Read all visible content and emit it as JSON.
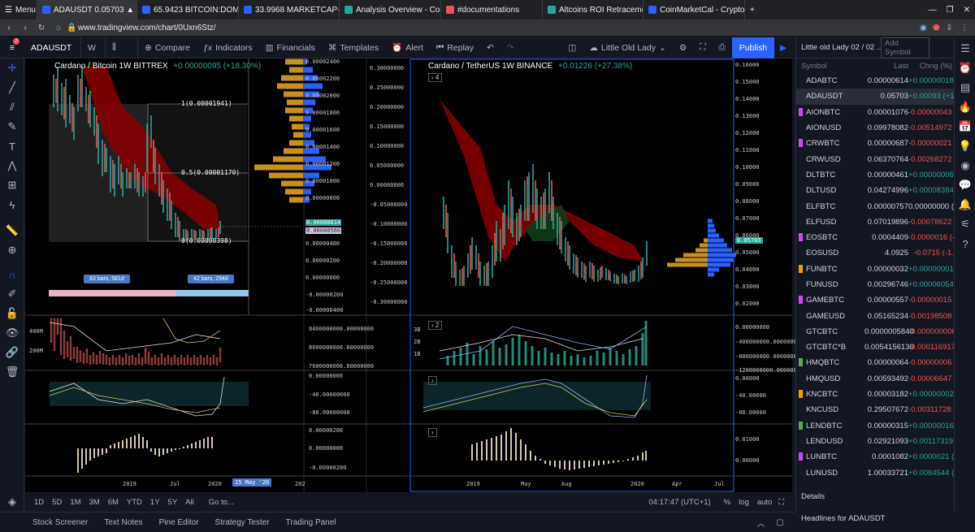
{
  "browser": {
    "menu_label": "Menu",
    "tabs": [
      {
        "title": "ADAUSDT 0.05703 ▲ +1.6€",
        "color": "#2962ff"
      },
      {
        "title": "65.9423 BITCOIN:DOMINA",
        "color": "#2962ff"
      },
      {
        "title": "33.9968 MARKETCAP-ALTC",
        "color": "#2962ff"
      },
      {
        "title": "Analysis Overview - CoinCh",
        "color": "#26a69a"
      },
      {
        "title": "#documentations",
        "color": "#ef5350"
      },
      {
        "title": "Altcoins ROI Retracements",
        "color": "#26a69a"
      },
      {
        "title": "CoinMarketCal - Cryptocur",
        "color": "#2962ff"
      }
    ],
    "url": "www.tradingview.com/chart/0Uxn6Stz/"
  },
  "toolbar": {
    "symbol": "ADAUSDT",
    "interval": "W",
    "compare": "Compare",
    "indicators": "Indicators",
    "financials": "Financials",
    "templates": "Templates",
    "alert": "Alert",
    "replay": "Replay",
    "layout_name": "Little Old Lady",
    "publish": "Publish"
  },
  "left_chart": {
    "title": "Cardano / Bitcoin   1W   BITTREX",
    "change": "+0.00000095 (+18.30%)",
    "fib_top": "1(0.00001941)",
    "fib_mid": "0.5(0.00001170)",
    "fib_bot": "0(0.00000398)",
    "range_left": "83 bars, 581d",
    "range_right": "42 bars, 294d",
    "price_ticks": [
      "0.00002400",
      "0.00002200",
      "0.00002000",
      "0.00001800",
      "0.00001600",
      "0.00001400",
      "0.00001200",
      "0.00001000",
      "0.00000800",
      "0.00000600",
      "0.00000400",
      "0.00000200",
      "0.00000000",
      "-0.00000200",
      "-0.00000400"
    ],
    "price_now": "0.00000614",
    "price_alt": "0.00000560",
    "scale2_ticks": [
      "0.30000000",
      "0.25000000",
      "0.20000000",
      "0.15000000",
      "0.10000000",
      "0.05000000",
      "0.00000000",
      "-0.05000000",
      "-0.10000000",
      "-0.15000000",
      "-0.20000000",
      "-0.25000000",
      "-0.30000000"
    ],
    "vol_ticks": [
      "400M",
      "200M"
    ],
    "vol_scale": [
      "8400000000.00000000",
      "8000000000.00000000",
      "7600000000.00000000"
    ],
    "osc_ticks": [
      "0.00000000",
      "-40.00000000",
      "-80.00000000"
    ],
    "macd_ticks": [
      "0.00000200",
      "0.00000000",
      "-0.00000200"
    ],
    "time_labels": [
      "2019",
      "Jul",
      "2020"
    ],
    "cursor_date": "25 May '20",
    "extra_label": "202"
  },
  "right_chart": {
    "title": "Cardano / TetherUS   1W   BINANCE",
    "change": "+0.01226 (+27.38%)",
    "legend_count": "4",
    "pane_count": "2",
    "price_ticks": [
      "0.16000",
      "0.15000",
      "0.14000",
      "0.13000",
      "0.12000",
      "0.11000",
      "0.10000",
      "0.09000",
      "0.08000",
      "0.07000",
      "0.06000",
      "0.05000",
      "0.04000",
      "0.03000",
      "0.02000"
    ],
    "price_now": "0.05703",
    "vol_ticks": [
      "3B",
      "2B",
      "1B"
    ],
    "vol_scale": [
      "0.00000000",
      "-400000000.00000000",
      "-800000000.00000000",
      "-1200000000.00000000"
    ],
    "osc_ticks": [
      "0.00000",
      "-40.00000",
      "-80.00000"
    ],
    "macd_ticks": [
      "0.01000",
      "0.00000"
    ],
    "time_labels": [
      "2019",
      "May",
      "Aug",
      "2020",
      "Apr",
      "Jul"
    ]
  },
  "timeframes": [
    "1D",
    "5D",
    "1M",
    "3M",
    "6M",
    "YTD",
    "1Y",
    "5Y",
    "All",
    "Go to..."
  ],
  "clock": "04:17:47 (UTC+1)",
  "scale_opts": [
    "%",
    "log",
    "auto"
  ],
  "bottom_tabs": [
    "Stock Screener",
    "Text Notes",
    "Pine Editor",
    "Strategy Tester",
    "Trading Panel"
  ],
  "watchlist": {
    "name": "Little old Lady 02 / 02 ...",
    "add": "Add Symbol",
    "headers": [
      "Symbol",
      "Last",
      "Chng (%)"
    ],
    "rows": [
      {
        "sym": "ADABTC",
        "last": "0.00000614",
        "chg": "+0.00000018 (+3.02%)",
        "dir": "up",
        "flag": ""
      },
      {
        "sym": "ADAUSDT",
        "last": "0.05703",
        "chg": "+0.00093 (+1.66%)",
        "dir": "up",
        "flag": "#2a2e39"
      },
      {
        "sym": "AIONBTC",
        "last": "0.00001076",
        "chg": "-0.00000043 (-3.84%)",
        "dir": "dn",
        "flag": "#e040fb"
      },
      {
        "sym": "AIONUSD",
        "last": "0.09978082",
        "chg": "-0.00514972 (-4.91%)",
        "dir": "dn",
        "flag": ""
      },
      {
        "sym": "CRWBTC",
        "last": "0.00000687",
        "chg": "-0.00000021 (-2.97%)",
        "dir": "dn",
        "flag": "#e040fb"
      },
      {
        "sym": "CRWUSD",
        "last": "0.06370764",
        "chg": "-0.00268272 (-4.04%)",
        "dir": "dn",
        "flag": ""
      },
      {
        "sym": "DLTBTC",
        "last": "0.00000461",
        "chg": "+0.00000006 (+1.32%)",
        "dir": "up",
        "flag": ""
      },
      {
        "sym": "DLTUSD",
        "last": "0.04274996",
        "chg": "+0.00008384 (+0.20%)",
        "dir": "up",
        "flag": ""
      },
      {
        "sym": "ELFBTC",
        "last": "0.00000757",
        "chg": "0.00000000 (0.00%)",
        "dir": "flat",
        "flag": ""
      },
      {
        "sym": "ELFUSD",
        "last": "0.07019896",
        "chg": "-0.00078622 (-1.11%)",
        "dir": "dn",
        "flag": ""
      },
      {
        "sym": "EOSBTC",
        "last": "0.0004409",
        "chg": "-0.0000016 (-0.36%)",
        "dir": "dn",
        "flag": "#e040fb"
      },
      {
        "sym": "EOSUSD",
        "last": "4.0925",
        "chg": "-0.0715 (-1.72%)",
        "dir": "dn",
        "flag": ""
      },
      {
        "sym": "FUNBTC",
        "last": "0.00000032",
        "chg": "+0.00000001 (+3.23%)",
        "dir": "up",
        "flag": "#ff9800"
      },
      {
        "sym": "FUNUSD",
        "last": "0.00296746",
        "chg": "+0.00006054 (+2.08%)",
        "dir": "up",
        "flag": ""
      },
      {
        "sym": "GAMEBTC",
        "last": "0.00000557",
        "chg": "-0.00000015 (-2.62%)",
        "dir": "dn",
        "flag": "#e040fb"
      },
      {
        "sym": "GAMEUSD",
        "last": "0.05165234",
        "chg": "-0.00198508 (-3.70%)",
        "dir": "dn",
        "flag": ""
      },
      {
        "sym": "GTCBTC",
        "last": "0.0000005840",
        "chg": "-0.0000000060 (-1.02",
        "dir": "dn",
        "flag": ""
      },
      {
        "sym": "GTCBTC*B",
        "last": "0.0054156130",
        "chg": "-0.0001169173 (-2.11",
        "dir": "dn",
        "flag": ""
      },
      {
        "sym": "HMQBTC",
        "last": "0.00000064",
        "chg": "-0.00000006 (-8.57%)",
        "dir": "dn",
        "flag": "#4caf50"
      },
      {
        "sym": "HMQUSD",
        "last": "0.00593492",
        "chg": "-0.00006647 (-1.11%)",
        "dir": "dn",
        "flag": ""
      },
      {
        "sym": "KNCBTC",
        "last": "0.00003182",
        "chg": "+0.00000002 (+0.06%)",
        "dir": "up",
        "flag": "#ff9800"
      },
      {
        "sym": "KNCUSD",
        "last": "0.29507672",
        "chg": "-0.00311728 (-1.05%)",
        "dir": "dn",
        "flag": ""
      },
      {
        "sym": "LENDBTC",
        "last": "0.00000315",
        "chg": "+0.00000016 (+5.35%)",
        "dir": "up",
        "flag": "#4caf50"
      },
      {
        "sym": "LENDUSD",
        "last": "0.02921093",
        "chg": "+0.00117319 (+4.18%)",
        "dir": "up",
        "flag": ""
      },
      {
        "sym": "LUNBTC",
        "last": "0.0001082",
        "chg": "+0.0000021 (+1.98%)",
        "dir": "up",
        "flag": "#e040fb"
      },
      {
        "sym": "LUNUSD",
        "last": "1.00033721",
        "chg": "+0.0084544 (+0.85%)",
        "dir": "up",
        "flag": ""
      }
    ],
    "details": "Details",
    "headlines": "Headlines for ADAUSDT"
  }
}
